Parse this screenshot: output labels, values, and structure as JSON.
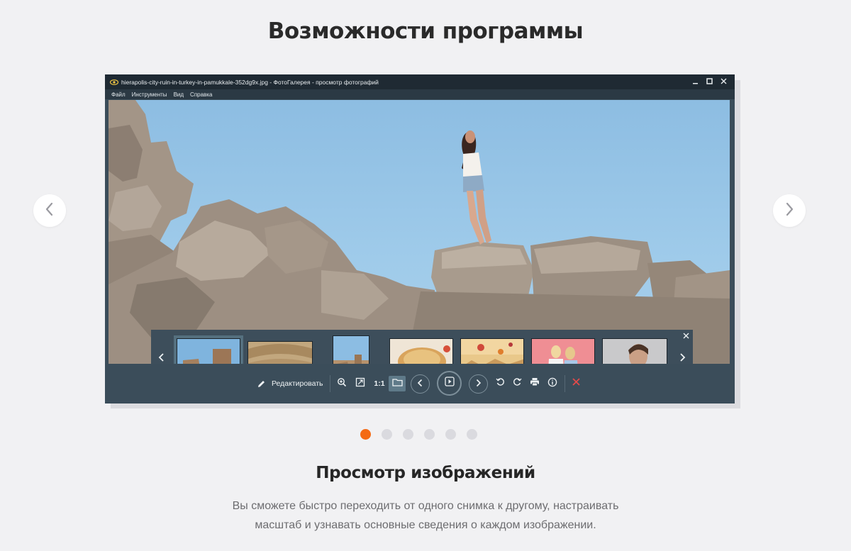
{
  "page": {
    "title": "Возможности программы",
    "section_title": "Просмотр изображений",
    "section_desc_line1": "Вы сможете быстро переходить от одного снимка к другому, настраивать",
    "section_desc_line2": "масштаб и узнавать основные сведения о каждом изображении.",
    "accent_color": "#f46a14"
  },
  "carousel": {
    "prev_icon": "chevron-left-icon",
    "next_icon": "chevron-right-icon",
    "dots_total": 6,
    "active_dot": 0
  },
  "window": {
    "title": "hierapolis-city-ruin-in-turkey-in-pamukkale-352dg9x.jpg - ФотоГалерея - просмотр фотографий",
    "controls": [
      "minimize-icon",
      "maximize-icon",
      "close-icon"
    ],
    "menu": [
      "Файл",
      "Инструменты",
      "Вид",
      "Справка"
    ]
  },
  "thumbnails": {
    "items": [
      "ruins",
      "amphitheater",
      "ruins-portrait",
      "pie",
      "balloons",
      "two-girls",
      "woman-portrait"
    ],
    "selected_index": 0
  },
  "toolbar": {
    "edit_label": "Редактировать",
    "ratio_label": "1:1",
    "icons": [
      "pencil-icon",
      "zoom-in-icon",
      "fit-screen-icon",
      "folder-icon",
      "previous-icon",
      "play-icon",
      "next-icon",
      "rotate-left-icon",
      "rotate-right-icon",
      "print-icon",
      "info-icon",
      "delete-icon"
    ],
    "delete_color": "#e24a4a"
  }
}
